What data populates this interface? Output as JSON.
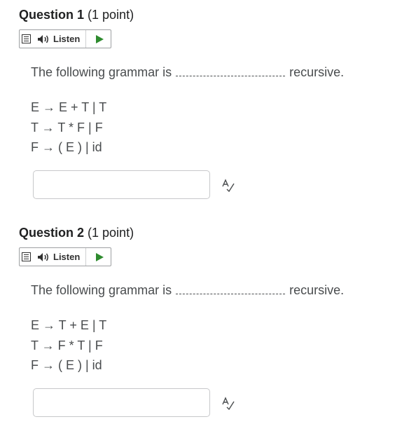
{
  "questions": [
    {
      "number": "Question 1",
      "points": "(1 point)",
      "listen_label": "Listen",
      "prompt_before": "The following grammar is",
      "prompt_after": "recursive.",
      "rules": [
        "E → E + T | T",
        "T → T * F | F",
        "F → ( E ) | id"
      ],
      "answer_value": ""
    },
    {
      "number": "Question 2",
      "points": "(1 point)",
      "listen_label": "Listen",
      "prompt_before": "The following grammar is",
      "prompt_after": "recursive.",
      "rules": [
        "E → T + E | T",
        "T → F * T | F",
        "F → ( E ) | id"
      ],
      "answer_value": ""
    }
  ],
  "icons": {
    "menu": "menu-icon",
    "speaker": "speaker-icon",
    "play": "play-icon",
    "spellcheck": "spellcheck-icon"
  },
  "colors": {
    "play": "#2e8b2e",
    "text": "#494c4e",
    "title": "#202122",
    "border": "#c7c8ca"
  }
}
